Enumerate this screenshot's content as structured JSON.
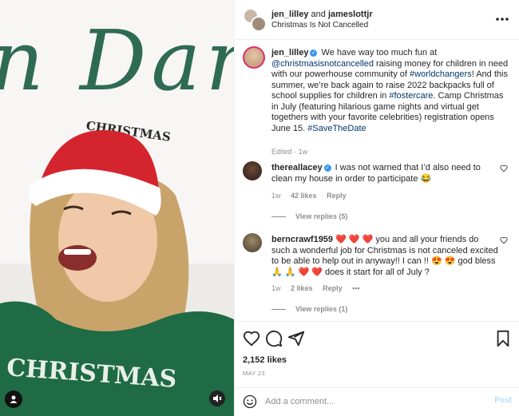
{
  "header": {
    "user1": "jen_lilley",
    "and": "and",
    "user2": "jameslottjr",
    "subtitle": "Christmas Is Not Cancelled"
  },
  "media": {
    "script_text": "n Darl",
    "shirt_text": "CHRISTMAS",
    "arc_text": "CHRISTMAS"
  },
  "caption": {
    "username": "jen_lilley",
    "t1": "We have way too much fun at",
    "mention": "@christmasisnotcancelled",
    "t2": "raising money for children in need with our powerhouse community of",
    "tag1": "#worldchangers",
    "t3": "! And this summer, we’re back again to raise 2022 backpacks full of school supplies for children in",
    "tag2": "#fostercare",
    "t4": ". Camp Christmas in July (featuring hilarious game nights and virtual get togethers with your favorite celebrities) registration opens June 15.",
    "tag3": "#SaveTheDate",
    "edited": "Edited",
    "dot": "·",
    "age": "1w"
  },
  "comments": [
    {
      "username": "thereallacey",
      "text": "I was not warned that I’d also need to clean my house in order to participate 😂",
      "age": "1w",
      "likes": "42 likes",
      "reply": "Reply",
      "view_replies": "View replies (5)"
    },
    {
      "username": "berncrawf1959",
      "text": "❤️ ❤️ ❤️ you and all your friends do such a wonderful job for Christmas is not canceled excited to be able to help out in anyway!! I can !! 😍 😍 god bless 🙏 🙏 ❤️ ❤️ does it start for all of July ?",
      "age": "1w",
      "likes": "2 likes",
      "reply": "Reply",
      "more": "•••",
      "view_replies": "View replies (1)"
    }
  ],
  "actions": {
    "likes": "2,152 likes",
    "date": "MAY 23"
  },
  "comment_box": {
    "placeholder": "Add a comment...",
    "post": "Post"
  },
  "colors": {
    "link": "#00376b",
    "verified": "#3897f0",
    "post_disabled": "#b2dffc",
    "sweater": "#1f6b45",
    "hat": "#d4242e"
  },
  "icons": [
    "more-icon",
    "verified-icon",
    "heart-icon",
    "comment-icon",
    "share-icon",
    "bookmark-icon",
    "emoji-icon",
    "user-icon",
    "mute-icon"
  ]
}
